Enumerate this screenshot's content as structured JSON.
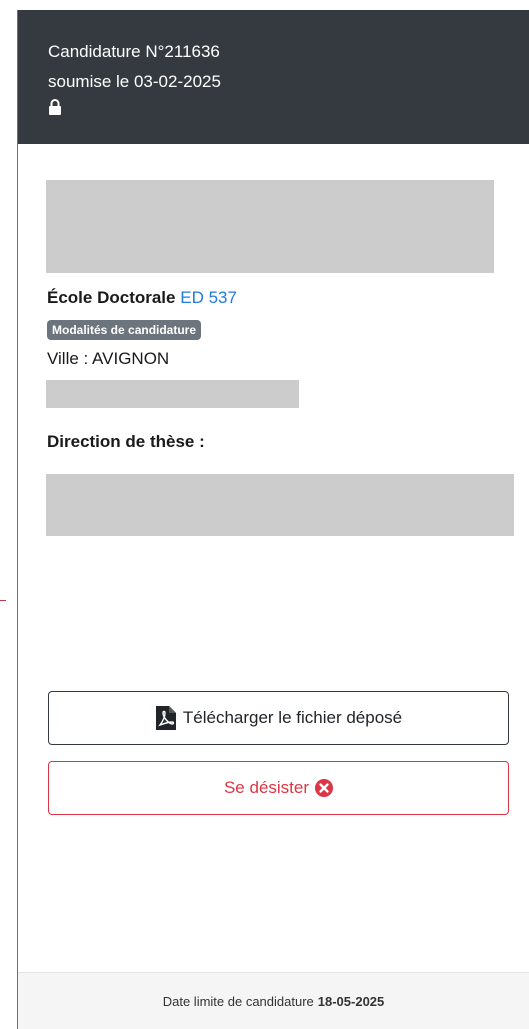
{
  "header": {
    "title": "Candidature N°211636",
    "submitted": "soumise le 03-02-2025",
    "lock_icon": "lock-icon"
  },
  "body": {
    "ecole_label": "École Doctorale",
    "ecole_link": "ED 537",
    "badge": "Modalités de candidature",
    "ville": "Ville : AVIGNON",
    "direction_label": "Direction de thèse :"
  },
  "actions": {
    "download_label": "Télécharger le fichier déposé",
    "download_icon": "pdf-file-icon",
    "desister_label": "Se désister",
    "desister_icon": "times-circle-icon"
  },
  "footer": {
    "deadline_label": "Date limite de candidature",
    "deadline_date": "18-05-2025"
  },
  "colors": {
    "header_bg": "#343a40",
    "link": "#1e7be0",
    "danger": "#dc3545",
    "badge_bg": "#6c757d"
  }
}
